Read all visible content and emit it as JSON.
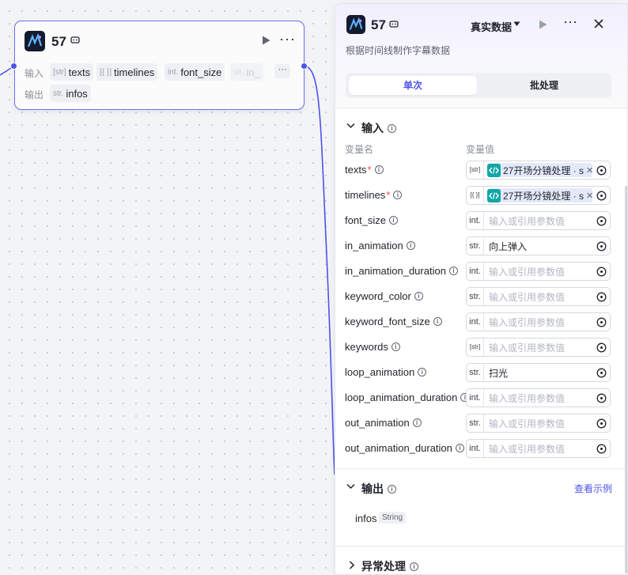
{
  "node": {
    "title": "57",
    "inputs_label": "输入",
    "outputs_label": "输出",
    "inputs": [
      {
        "type": "[str]",
        "name": "texts"
      },
      {
        "type": "[{ }]",
        "name": "timelines"
      },
      {
        "type": "int.",
        "name": "font_size"
      },
      {
        "type": "str.",
        "name": "in_"
      }
    ],
    "outputs": [
      {
        "type": "str.",
        "name": "infos"
      }
    ],
    "more_label": "···"
  },
  "panel": {
    "title": "57",
    "mode": "真实数据",
    "description": "根据时间线制作字幕数据",
    "tabs": [
      "单次",
      "批处理"
    ],
    "inputs_section": "输入",
    "col_name": "变量名",
    "col_value": "变量值",
    "variables": [
      {
        "name": "texts",
        "required": true,
        "type": "[str]",
        "value": "27开场分镜处理 · s",
        "kind": "ref"
      },
      {
        "name": "timelines",
        "required": true,
        "type": "[{ }]",
        "value": "27开场分镜处理 · s",
        "kind": "ref"
      },
      {
        "name": "font_size",
        "required": false,
        "type": "int.",
        "value": "输入或引用参数值",
        "kind": "placeholder"
      },
      {
        "name": "in_animation",
        "required": false,
        "type": "str.",
        "value": "向上弹入",
        "kind": "text"
      },
      {
        "name": "in_animation_duration",
        "required": false,
        "type": "int.",
        "value": "输入或引用参数值",
        "kind": "placeholder"
      },
      {
        "name": "keyword_color",
        "required": false,
        "type": "str.",
        "value": "输入或引用参数值",
        "kind": "placeholder"
      },
      {
        "name": "keyword_font_size",
        "required": false,
        "type": "int.",
        "value": "输入或引用参数值",
        "kind": "placeholder"
      },
      {
        "name": "keywords",
        "required": false,
        "type": "[str]",
        "value": "输入或引用参数值",
        "kind": "placeholder"
      },
      {
        "name": "loop_animation",
        "required": false,
        "type": "str.",
        "value": "扫光",
        "kind": "text"
      },
      {
        "name": "loop_animation_duration",
        "required": false,
        "type": "int.",
        "value": "输入或引用参数值",
        "kind": "placeholder"
      },
      {
        "name": "out_animation",
        "required": false,
        "type": "str.",
        "value": "输入或引用参数值",
        "kind": "placeholder"
      },
      {
        "name": "out_animation_duration",
        "required": false,
        "type": "int.",
        "value": "输入或引用参数值",
        "kind": "placeholder"
      }
    ],
    "outputs_section": "输出",
    "view_example": "查看示例",
    "output": {
      "name": "infos",
      "type": "String"
    },
    "exception_section": "异常处理"
  },
  "colors": {
    "accent": "#4d53e8",
    "ref_icon": "#10a7a7",
    "required": "#f54a45"
  }
}
